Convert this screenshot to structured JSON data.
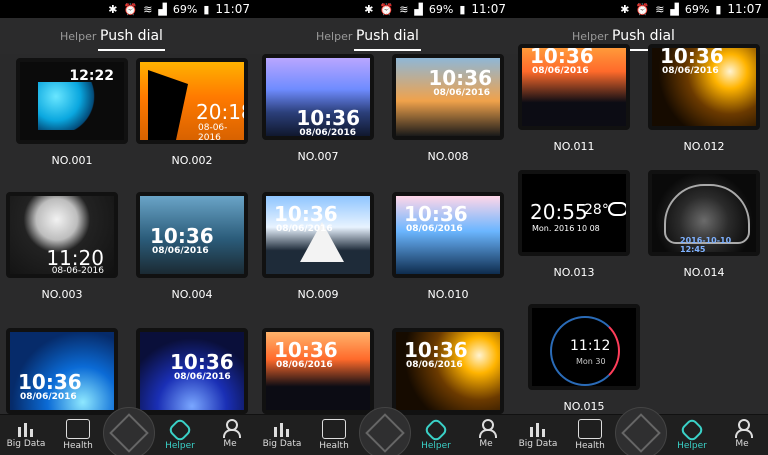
{
  "status": {
    "battery": "69%",
    "time": "11:07"
  },
  "tabs": {
    "helper": "Helper",
    "push_dial": "Push dial"
  },
  "panels": [
    {
      "dials": [
        {
          "no": "NO.001",
          "time": "12:22",
          "date": ""
        },
        {
          "no": "NO.002",
          "time": "20:18",
          "date": "08-06-2016"
        },
        {
          "no": "NO.003",
          "time": "11:20",
          "date": "08-06-2016"
        },
        {
          "no": "NO.004",
          "time": "10:36",
          "date": "08/06/2016"
        },
        {
          "no": "",
          "time": "10:36",
          "date": "08/06/2016"
        },
        {
          "no": "",
          "time": "10:36",
          "date": "08/06/2016"
        }
      ]
    },
    {
      "dials": [
        {
          "no": "NO.007",
          "time": "10:36",
          "date": "08/06/2016"
        },
        {
          "no": "NO.008",
          "time": "10:36",
          "date": "08/06/2016"
        },
        {
          "no": "NO.009",
          "time": "10:36",
          "date": "08/06/2016"
        },
        {
          "no": "NO.010",
          "time": "10:36",
          "date": "08/06/2016"
        },
        {
          "no": "",
          "time": "10:36",
          "date": "08/06/2016"
        },
        {
          "no": "",
          "time": "10:36",
          "date": "08/06/2016"
        }
      ]
    },
    {
      "dials": [
        {
          "no": "NO.011",
          "time": "10:36",
          "date": "08/06/2016"
        },
        {
          "no": "NO.012",
          "time": "10:36",
          "date": "08/06/2016"
        },
        {
          "no": "NO.013",
          "time": "20:55",
          "date": "Mon. 2016 10 08",
          "extra": "28°"
        },
        {
          "no": "NO.014",
          "time": "",
          "date": "2016-10-10 12:45"
        },
        {
          "no": "NO.015",
          "time": "11:12",
          "date": "Mon 30"
        }
      ]
    }
  ],
  "nav": {
    "bigdata": "Big Data",
    "health": "Health",
    "helper": "Helper",
    "me": "Me"
  },
  "colors": {
    "accent": "#3ad1c7"
  }
}
